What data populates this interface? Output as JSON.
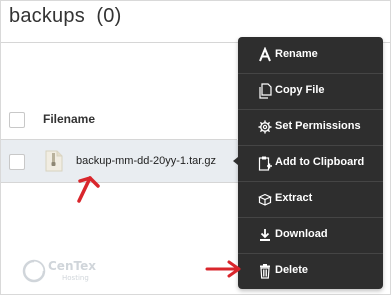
{
  "page": {
    "title": "backups",
    "count": "(0)"
  },
  "table": {
    "columns": [
      "Filename"
    ],
    "rows": [
      {
        "filename": "backup-mm-dd-20yy-1.tar.gz",
        "icon": "archive-file-icon"
      }
    ]
  },
  "context_menu": {
    "items": [
      {
        "label": "Rename",
        "icon": "rename-a-icon"
      },
      {
        "label": "Copy File",
        "icon": "copy-file-icon"
      },
      {
        "label": "Set Permissions",
        "icon": "gear-icon"
      },
      {
        "label": "Add to Clipboard",
        "icon": "clipboard-icon"
      },
      {
        "label": "Extract",
        "icon": "extract-box-icon"
      },
      {
        "label": "Download",
        "icon": "download-icon"
      },
      {
        "label": "Delete",
        "icon": "trash-icon"
      }
    ]
  },
  "branding": {
    "name": "CenTex",
    "tagline": "Hosting"
  },
  "colors": {
    "menu_bg": "#2e2e2e",
    "row_highlight": "#e9edf1",
    "annotation_arrow": "#d9262c"
  }
}
